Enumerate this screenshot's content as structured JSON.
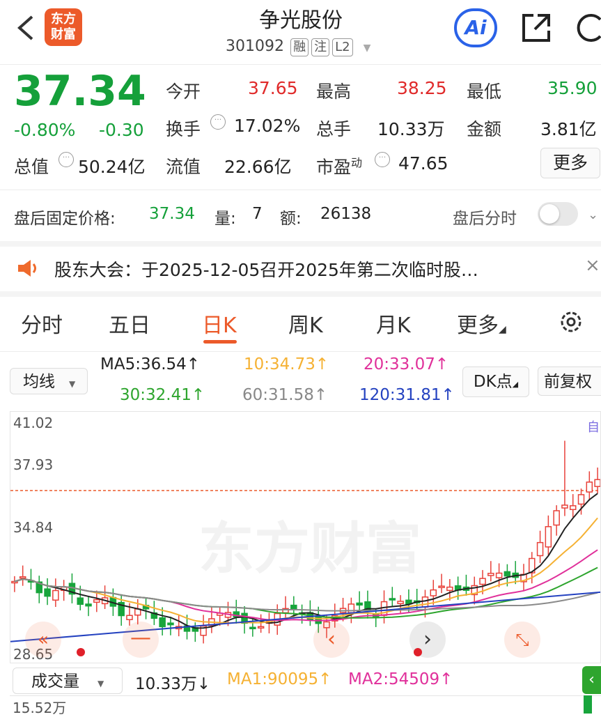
{
  "header": {
    "back_icon": "chevron-left-icon",
    "logo_text_line1": "东方",
    "logo_text_line2": "财富",
    "stock_name": "争光股份",
    "stock_code": "301092",
    "tags": [
      "融",
      "注",
      "L2"
    ],
    "ai_label": "Ai",
    "share_icon": "share-icon",
    "refresh_icon": "refresh-icon"
  },
  "quote": {
    "price": "37.34",
    "change_pct": "-0.80%",
    "change_amt": "-0.30",
    "open_label": "今开",
    "open": "37.65",
    "high_label": "最高",
    "high": "38.25",
    "low_label": "最低",
    "low": "35.90",
    "turnover_label": "换手",
    "turnover": "17.02%",
    "volume_label": "总手",
    "volume": "10.33万",
    "amount_label": "金额",
    "amount": "3.81亿",
    "mktcap_label": "总值",
    "mktcap": "50.24亿",
    "float_label": "流值",
    "float_cap": "22.66亿",
    "pe_label": "市盈",
    "pe_sup": "动",
    "pe": "47.65",
    "more_button": "更多"
  },
  "after_hours": {
    "price_label": "盘后固定价格:",
    "price": "37.34",
    "qty_label": "量:",
    "qty": "7",
    "amt_label": "额:",
    "amt": "26138",
    "timeshare_label": "盘后分时"
  },
  "notice": {
    "text": "股东大会：于2025-12-05召开2025年第二次临时股…",
    "close": "×"
  },
  "tabs": [
    "分时",
    "五日",
    "日K",
    "周K",
    "月K",
    "更多"
  ],
  "active_tab": "日K",
  "ma_bar": {
    "selector": "均线",
    "ma5": "MA5:36.54↑",
    "ma10": "10:34.73↑",
    "ma20": "20:33.07↑",
    "ma30": "30:32.41↑",
    "ma60": "60:31.58↑",
    "ma120": "120:31.81↑",
    "dk_button": "DK点",
    "adjust_button": "前复权"
  },
  "chart": {
    "y_labels": [
      "41.02",
      "37.93",
      "34.84",
      "28.65"
    ],
    "watermark": "东方财富",
    "side_label": "自",
    "colors": {
      "up": "#e8413a",
      "down": "#18a53c",
      "ma5": "#222222",
      "ma10": "#f5b133",
      "ma20": "#e0309a",
      "ma30": "#2ea52e",
      "ma60": "#8a8a8a",
      "ma120": "#2442c0"
    }
  },
  "volume_bar": {
    "selector": "成交量",
    "volume": "10.33万↓",
    "ma1": "MA1:90095↑",
    "ma2": "MA2:54509↑",
    "y_top": "15.52万"
  }
}
